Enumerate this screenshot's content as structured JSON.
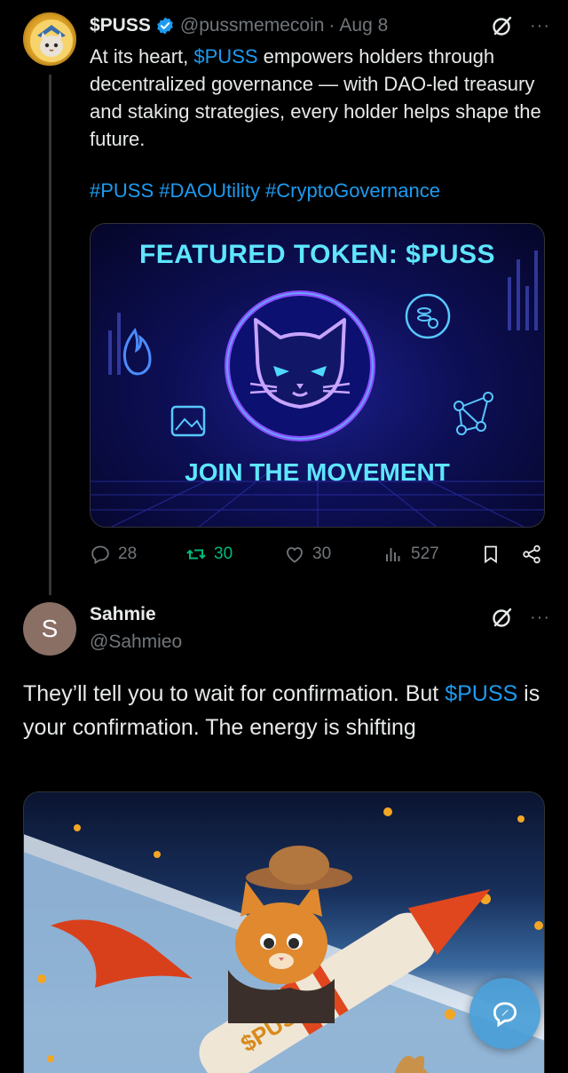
{
  "tweet1": {
    "name": "$PUSS",
    "handle": "@pussmemecoin",
    "separator": "·",
    "date": "Aug 8",
    "more": "···",
    "body_prefix": "At its heart, ",
    "body_link": "$PUSS",
    "body_rest": " empowers holders through decentralized governance — with DAO-led treasury and staking strategies, every holder helps shape the future.",
    "hashtags": "#PUSS #DAOUtility #CryptoGovernance",
    "media": {
      "title": "FEATURED TOKEN: $PUSS",
      "subtitle": "JOIN THE MOVEMENT"
    },
    "stats": {
      "replies": "28",
      "reposts": "30",
      "likes": "30",
      "views": "527"
    }
  },
  "tweet2": {
    "avatar_letter": "S",
    "name": "Sahmie",
    "handle": "@Sahmieo",
    "more": "···",
    "body_prefix": "They’ll tell you to wait for confirmation. But ",
    "body_link": "$PUSS",
    "body_rest": " is your confirmation. The energy is shifting",
    "rocket_text": "$PUSS"
  },
  "colors": {
    "accent": "#1d9bf0",
    "muted": "#71767b",
    "repost_active": "#00ba7c",
    "neon": "#5ee6ff"
  },
  "icons": [
    "verified-badge-icon",
    "grok-icon",
    "more-icon",
    "reply-icon",
    "repost-icon",
    "like-icon",
    "views-icon",
    "bookmark-icon",
    "share-icon",
    "compose-icon"
  ]
}
